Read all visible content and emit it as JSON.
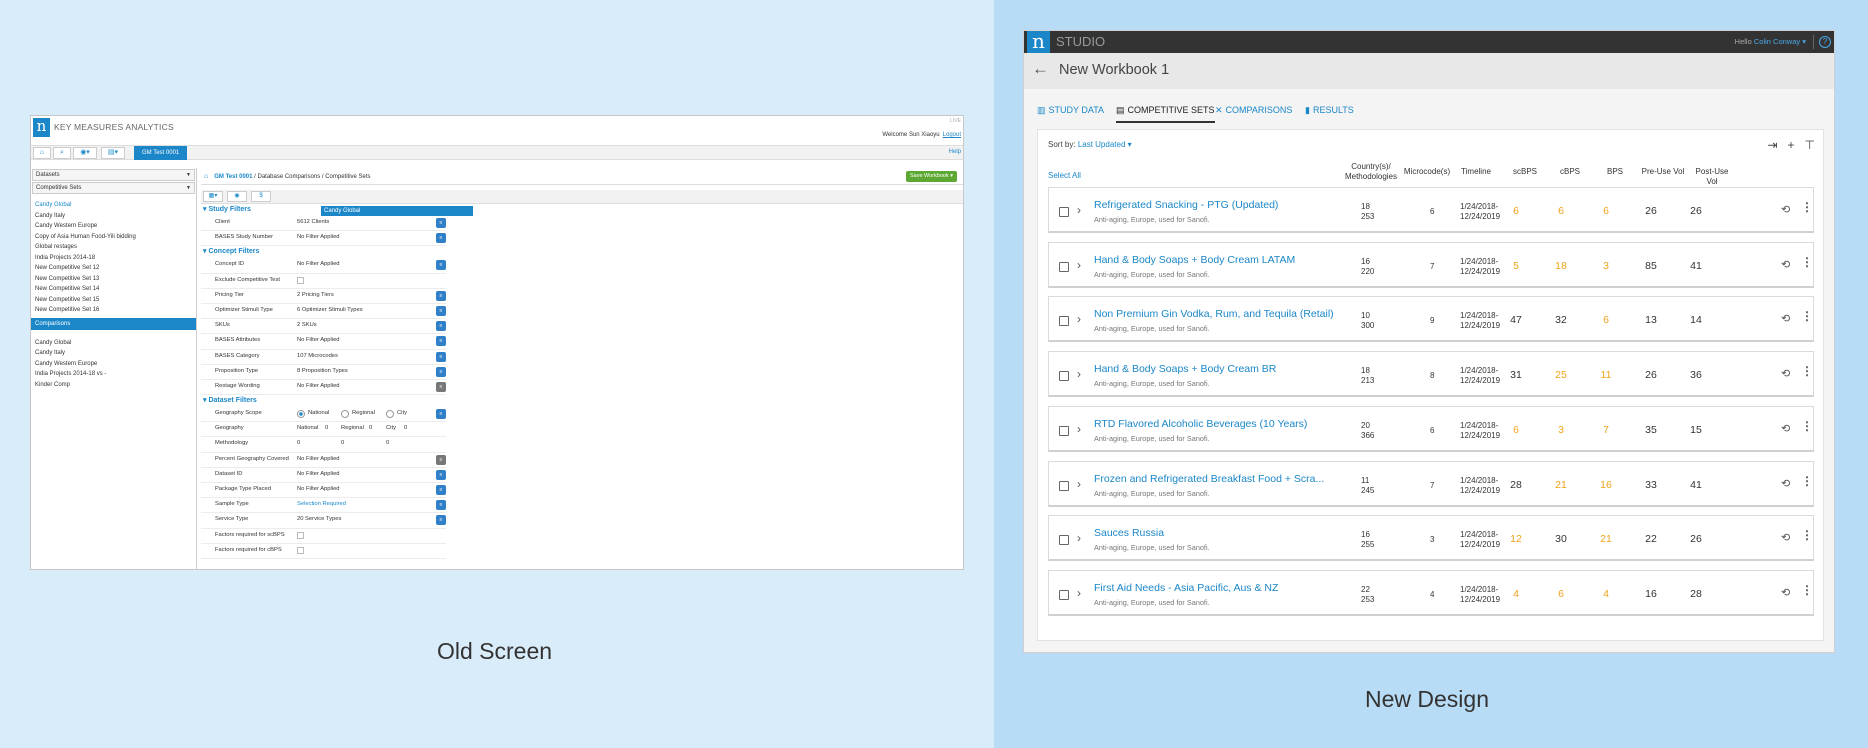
{
  "captions": {
    "old": "Old Screen",
    "new": "New Design"
  },
  "old": {
    "logo": "n",
    "app_title": "KEY MEASURES ANALYTICS",
    "env": "LIVE",
    "welcome": "Welcome Sun Xiaoyu",
    "logout": "Logout",
    "help": "Help",
    "tab": "GM Test 0001",
    "datasets_dd": "Datasets",
    "comp_sets_dd": "Competitive Sets",
    "list": [
      "Candy Global",
      "Candy Italy",
      "Candy Western Europe",
      "Copy of Asia Human Food-Yili bidding",
      "Global restages",
      "India Projects 2014-18",
      "New Competitive Set 12",
      "New Competitive Set 13",
      "New Competitive Set 14",
      "New Competitive Set 15",
      "New Competitive Set 16"
    ],
    "comparisons": "Comparisons",
    "list2": [
      "Candy Global",
      "Candy Italy",
      "Candy Western Europe",
      "India Projects 2014-18 vs -",
      "Kinder Comp"
    ],
    "breadcrumb_root": "GM Test 0001",
    "breadcrumb_path": "/ Database Comparisons / Competitive Sets",
    "save_workbook": "Save Workbook",
    "popup": "Candy Global",
    "sections": {
      "study": "Study Filters",
      "concept": "Concept Filters",
      "dataset": "Dataset Filters"
    },
    "study_rows": [
      {
        "label": "Client",
        "value": "5612 Clients"
      },
      {
        "label": "BASES Study Number",
        "value": "No Filter Applied"
      }
    ],
    "concept_rows": [
      {
        "label": "Concept ID",
        "value": "No Filter Applied"
      },
      {
        "label": "Exclude Competitive Test",
        "value": ""
      },
      {
        "label": "Pricing Tier",
        "value": "2 Pricing Tiers"
      },
      {
        "label": "Optimizer Stimuli Type",
        "value": "6 Optimizer Stimuli Types"
      },
      {
        "label": "SKUs",
        "value": "2 SKUs"
      },
      {
        "label": "BASES Attributes",
        "value": "No Filter Applied"
      },
      {
        "label": "BASES Category",
        "value": "107 Microcodes"
      },
      {
        "label": "Proposition Type",
        "value": "8 Proposition Types"
      },
      {
        "label": "Restage Wording",
        "value": "No Filter Applied"
      }
    ],
    "geo_scope": {
      "label": "Geography Scope",
      "national": "National",
      "regional": "Regional",
      "city": "City"
    },
    "geography": {
      "label": "Geography",
      "national": "National",
      "national_v": "0",
      "regional": "Regional",
      "regional_v": "0",
      "city": "City",
      "city_v": "0"
    },
    "methodology": {
      "label": "Methodology",
      "v1": "0",
      "v2": "0",
      "v3": "0"
    },
    "dataset_rows": [
      {
        "label": "Percent Geography Covered",
        "value": "No Filter Applied"
      },
      {
        "label": "Dataset ID",
        "value": "No Filter Applied"
      },
      {
        "label": "Package Type Placed",
        "value": "No Filter Applied"
      },
      {
        "label": "Sample Type",
        "value": "Selection Required"
      },
      {
        "label": "Service Type",
        "value": "20 Service Types"
      },
      {
        "label": "Factors required for scBPS",
        "value": ""
      },
      {
        "label": "Factors required for cBPS",
        "value": ""
      }
    ]
  },
  "new": {
    "logo": "n",
    "studio": "STUDIO",
    "hello": "Hello",
    "user": "Colin Conway",
    "help": "?",
    "title": "New Workbook 1",
    "tabs": [
      "STUDY DATA",
      "COMPETITIVE SETS",
      "COMPARISONS",
      "RESULTS"
    ],
    "sort_label": "Sort by:",
    "sort_value": "Last Updated",
    "select_all": "Select All",
    "columns": [
      "Country(s)/ Methodologies",
      "Microcode(s)",
      "Timeline",
      "scBPS",
      "cBPS",
      "BPS",
      "Pre-Use Vol",
      "Post-Use Vol"
    ],
    "rows": [
      {
        "title": "Refrigerated Snacking - PTG (Updated)",
        "sub": "Anti-aging, Europe, used for Sanofi.",
        "c1": "18",
        "c2": "253",
        "micro": "6",
        "t1": "1/24/2018-",
        "t2": "12/24/2019",
        "scbps": "6",
        "cbps": "6",
        "bps": "6",
        "pre": "26",
        "post": "26"
      },
      {
        "title": "Hand & Body Soaps + Body Cream LATAM",
        "sub": "Anti-aging, Europe, used for Sanofi.",
        "c1": "16",
        "c2": "220",
        "micro": "7",
        "t1": "1/24/2018-",
        "t2": "12/24/2019",
        "scbps": "5",
        "cbps": "18",
        "bps": "3",
        "pre": "85",
        "post": "41"
      },
      {
        "title": "Non Premium Gin Vodka, Rum, and Tequila (Retail)",
        "sub": "Anti-aging, Europe, used for Sanofi.",
        "c1": "10",
        "c2": "300",
        "micro": "9",
        "t1": "1/24/2018-",
        "t2": "12/24/2019",
        "scbps": "47",
        "cbps": "32",
        "bps": "6",
        "pre": "13",
        "post": "14"
      },
      {
        "title": "Hand & Body Soaps + Body Cream BR",
        "sub": "Anti-aging, Europe, used for Sanofi.",
        "c1": "18",
        "c2": "213",
        "micro": "8",
        "t1": "1/24/2018-",
        "t2": "12/24/2019",
        "scbps": "31",
        "cbps": "25",
        "bps": "11",
        "pre": "26",
        "post": "36"
      },
      {
        "title": "RTD Flavored Alcoholic Beverages (10 Years)",
        "sub": "Anti-aging, Europe, used for Sanofi.",
        "c1": "20",
        "c2": "366",
        "micro": "6",
        "t1": "1/24/2018-",
        "t2": "12/24/2019",
        "scbps": "6",
        "cbps": "3",
        "bps": "7",
        "pre": "35",
        "post": "15"
      },
      {
        "title": "Frozen and Refrigerated Breakfast Food + Scra...",
        "sub": "Anti-aging, Europe, used for Sanofi.",
        "c1": "11",
        "c2": "245",
        "micro": "7",
        "t1": "1/24/2018-",
        "t2": "12/24/2019",
        "scbps": "28",
        "cbps": "21",
        "bps": "16",
        "pre": "33",
        "post": "41"
      },
      {
        "title": "Sauces Russia",
        "sub": "Anti-aging, Europe, used for Sanofi.",
        "c1": "16",
        "c2": "255",
        "micro": "3",
        "t1": "1/24/2018-",
        "t2": "12/24/2019",
        "scbps": "12",
        "cbps": "30",
        "bps": "21",
        "pre": "22",
        "post": "26"
      },
      {
        "title": "First Aid Needs - Asia Pacific, Aus & NZ",
        "sub": "Anti-aging, Europe, used for Sanofi.",
        "c1": "22",
        "c2": "253",
        "micro": "4",
        "t1": "1/24/2018-",
        "t2": "12/24/2019",
        "scbps": "4",
        "cbps": "6",
        "bps": "4",
        "pre": "16",
        "post": "28"
      }
    ],
    "orange": "#f0a31b",
    "accent": "#1b87c8"
  }
}
